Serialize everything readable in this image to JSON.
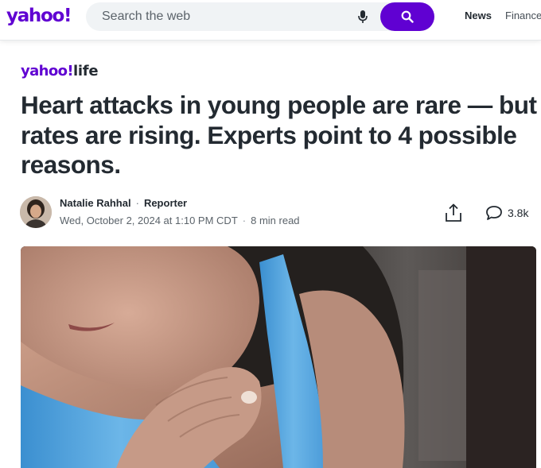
{
  "header": {
    "logo_text": "yahoo!",
    "search": {
      "placeholder": "Search the web",
      "value": ""
    },
    "nav": [
      {
        "label": "News"
      },
      {
        "label": "Finance"
      }
    ],
    "brand_color": "#6001d2"
  },
  "article": {
    "section_brand": {
      "prefix": "yahoo!",
      "suffix": "life"
    },
    "headline": "Heart attacks in young people are rare — but rates are rising. Experts point to 4 possible reasons.",
    "author": {
      "name": "Natalie Rahhal",
      "role": "Reporter"
    },
    "timestamp": "Wed, October 2, 2024 at 1:10 PM CDT",
    "read_time": "8 min read",
    "comments_count": "3.8k",
    "icons": {
      "search_button": "search-icon",
      "mic": "microphone-icon",
      "share": "share-icon",
      "comments": "comment-icon"
    }
  }
}
